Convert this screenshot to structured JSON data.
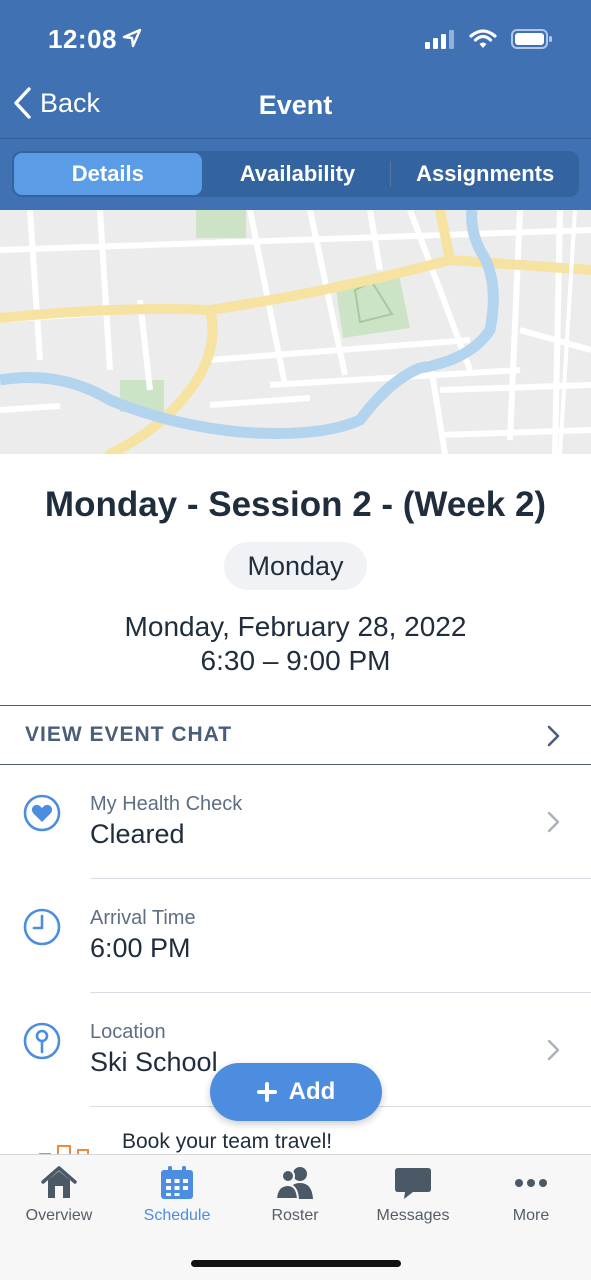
{
  "status_bar": {
    "time": "12:08"
  },
  "nav": {
    "back_label": "Back",
    "title": "Event"
  },
  "tabs": [
    {
      "label": "Details",
      "active": true
    },
    {
      "label": "Availability",
      "active": false
    },
    {
      "label": "Assignments",
      "active": false
    }
  ],
  "event": {
    "title": "Monday - Session 2 - (Week 2)",
    "day_badge": "Monday",
    "date": "Monday, February 28, 2022",
    "time_range": "6:30 – 9:00 PM"
  },
  "chat": {
    "label": "VIEW EVENT CHAT"
  },
  "details": [
    {
      "label": "My Health Check",
      "value": "Cleared",
      "icon": "heart-icon"
    },
    {
      "label": "Arrival Time",
      "value": "6:00 PM",
      "icon": "clock-icon"
    },
    {
      "label": "Location",
      "value": "Ski School",
      "icon": "pin-icon"
    }
  ],
  "promo": {
    "text": "Book your team travel!"
  },
  "fab": {
    "label": "Add"
  },
  "tabbar": [
    {
      "label": "Overview",
      "icon": "home-icon",
      "active": false
    },
    {
      "label": "Schedule",
      "icon": "calendar-icon",
      "active": true
    },
    {
      "label": "Roster",
      "icon": "people-icon",
      "active": false
    },
    {
      "label": "Messages",
      "icon": "chat-bubble-icon",
      "active": false
    },
    {
      "label": "More",
      "icon": "more-icon",
      "active": false
    }
  ],
  "colors": {
    "header": "#3f71b3",
    "accent": "#4d8de0",
    "text": "#1f2d3d",
    "muted": "#5e6f84"
  }
}
